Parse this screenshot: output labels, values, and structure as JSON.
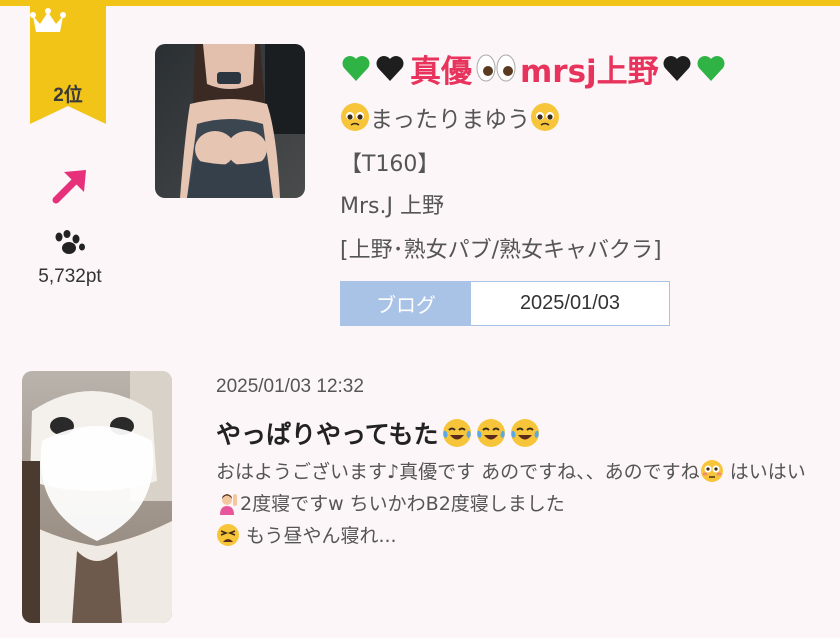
{
  "ranking": {
    "rank_label": "2位",
    "points": "5,732pt",
    "trend": "up",
    "badge_color": "#f2c418"
  },
  "profile": {
    "name": "真優",
    "name_suffix": "mrsj上野",
    "name_color": "#e8345d",
    "nickname": "まったりまゆう",
    "tall": "【T160】",
    "shop": "Mrs.J 上野",
    "category": "[上野･熟女パブ/熟女キャバクラ]"
  },
  "blog_box": {
    "label": "ブログ",
    "date": "2025/01/03",
    "accent": "#a9c3e6"
  },
  "post": {
    "timestamp": "2025/01/03 12:32",
    "title": "やっぱりやってもた",
    "excerpt_1": "おはようございます♪真優です あのですね、、あのですね",
    "excerpt_2": " はいはい",
    "excerpt_3": "2度寝ですw ちいかわB2度寝しました",
    "excerpt_4": " もう昼やん寝れ..."
  },
  "icons": {
    "crown": "crown-icon",
    "trend": "trend-up-icon",
    "paw": "paw-icon",
    "heart_green": "green-heart-icon",
    "heart_black": "black-heart-icon",
    "eyes": "eyes-icon",
    "pleading": "pleading-face-icon",
    "tears": "tears-of-joy-icon",
    "flushed": "flushed-face-icon",
    "raising_hand": "raising-hand-icon",
    "tired": "tired-face-icon"
  }
}
